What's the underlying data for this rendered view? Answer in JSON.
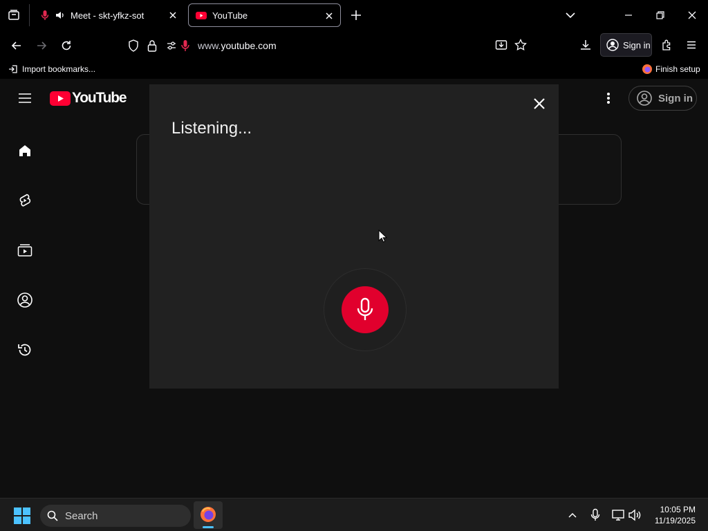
{
  "browser": {
    "tabs": [
      {
        "title": "Meet - skt-yfkz-sot",
        "active": false
      },
      {
        "title": "YouTube",
        "active": true
      }
    ],
    "url_prefix": "www.",
    "url_host": "youtube.com",
    "signin_label": "Sign in",
    "bookmarks": {
      "import_label": "Import bookmarks...",
      "finish_setup_label": "Finish setup"
    }
  },
  "youtube": {
    "logo_text": "YouTube",
    "signin_label": "Sign in",
    "sidebar": [
      "home-icon",
      "shorts-icon",
      "subscriptions-icon",
      "you-icon",
      "history-icon"
    ]
  },
  "voice_dialog": {
    "status_text": "Listening..."
  },
  "taskbar": {
    "search_label": "Search",
    "time": "10:05 PM",
    "date": "11/19/2025"
  },
  "colors": {
    "accent_red": "#e1002d",
    "modal_bg": "#212121",
    "page_bg": "#0f0f0f"
  }
}
